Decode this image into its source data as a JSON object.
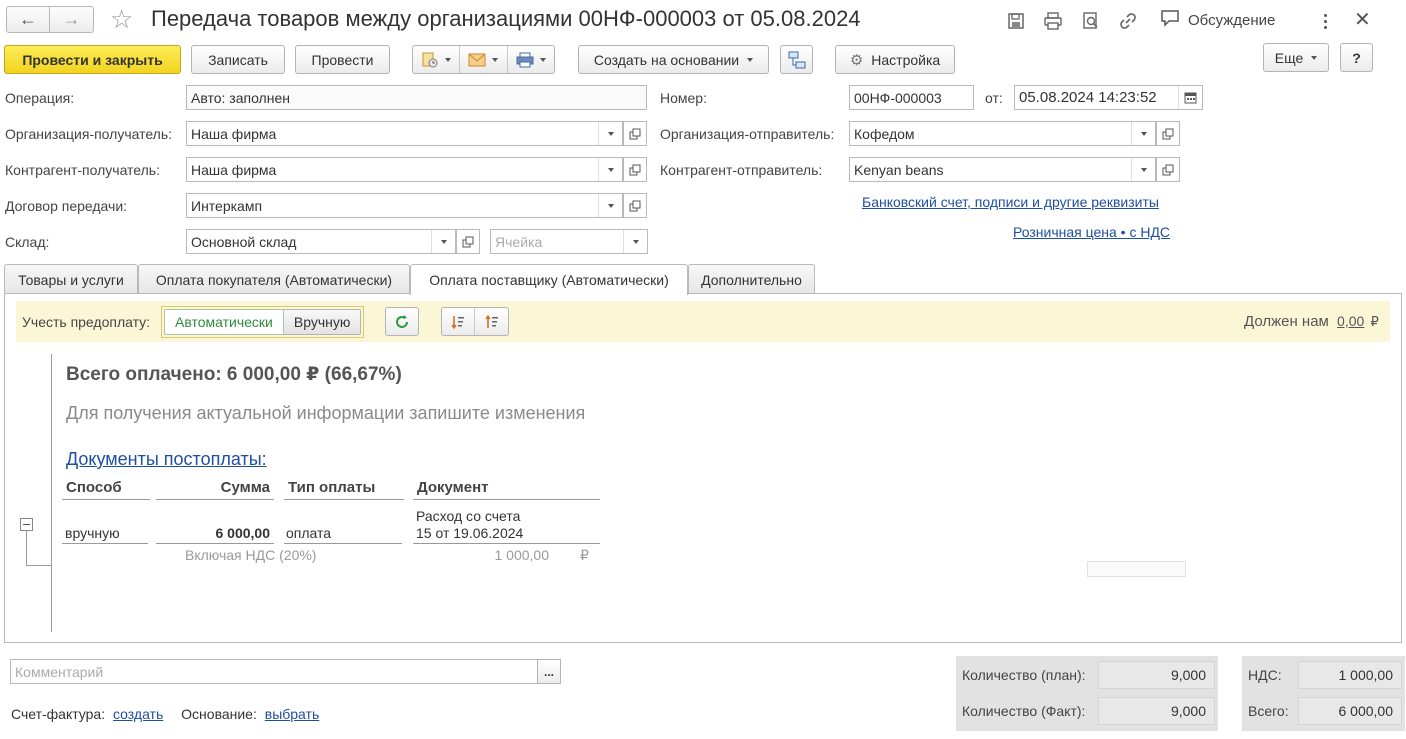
{
  "window": {
    "title": "Передача товаров между организациями 00НФ-000003 от  05.08.2024",
    "discussion_label": "Обсуждение"
  },
  "toolbar": {
    "post_close": "Провести и закрыть",
    "save": "Записать",
    "post": "Провести",
    "create_based": "Создать на основании",
    "settings": "Настройка",
    "more": "Еще",
    "help": "?"
  },
  "form": {
    "operation_label": "Операция:",
    "operation_value": "Авто: заполнен",
    "number_label": "Номер:",
    "number_value": "00НФ-000003",
    "date_label": "от:",
    "date_value": "05.08.2024 14:23:52",
    "org_receiver_label": "Организация-получатель:",
    "org_receiver_value": "Наша фирма",
    "org_sender_label": "Организация-отправитель:",
    "org_sender_value": "Кофедом",
    "contractor_receiver_label": "Контрагент-получатель:",
    "contractor_receiver_value": "Наша фирма",
    "contractor_sender_label": "Контрагент-отправитель:",
    "contractor_sender_value": "Kenyan beans",
    "contract_label": "Договор передачи:",
    "contract_value": "Интеркамп",
    "bank_link": "Банковский счет, подписи и другие реквизиты",
    "warehouse_label": "Склад:",
    "warehouse_value": "Основной склад",
    "cell_placeholder": "Ячейка",
    "price_link": "Розничная цена • с НДС"
  },
  "tabs": [
    {
      "label": "Товары и услуги"
    },
    {
      "label": "Оплата покупателя (Автоматически)"
    },
    {
      "label": "Оплата поставщику (Автоматически)"
    },
    {
      "label": "Дополнительно"
    }
  ],
  "payment": {
    "prepay_label": "Учесть предоплату:",
    "mode_auto": "Автоматически",
    "mode_manual": "Вручную",
    "owed_label": "Должен нам",
    "owed_value": "0,00",
    "currency": "₽",
    "total_paid": "Всего оплачено: 6 000,00 ₽ (66,67%)",
    "info": "Для получения актуальной информации запишите изменения",
    "docs_link": "Документы постоплаты:",
    "columns": [
      "Способ",
      "Сумма",
      "Тип оплаты",
      "Документ"
    ],
    "row": {
      "method": "вручную",
      "amount": "6 000,00",
      "pay_type": "оплата",
      "doc_line1": "Расход со счета",
      "doc_line2": "15 от 19.06.2024",
      "vat_label": "Включая НДС (20%)",
      "vat_value": "1 000,00",
      "vat_currency": "₽"
    }
  },
  "footer": {
    "comment_placeholder": "Комментарий",
    "comment_btn": "...",
    "invoice_label": "Счет-фактура:",
    "invoice_link": "создать",
    "basis_label": "Основание:",
    "basis_link": "выбрать",
    "qty_plan_label": "Количество (план):",
    "qty_plan_value": "9,000",
    "qty_fact_label": "Количество (Факт):",
    "qty_fact_value": "9,000",
    "vat_label": "НДС:",
    "vat_value": "1 000,00",
    "total_label": "Всего:",
    "total_value": "6 000,00"
  },
  "colors": {
    "primary_button": "#f5dc2c",
    "link": "#1f4fa0",
    "prepay_bar": "#fbf7d6",
    "toggle_active": "#2e8b3e"
  }
}
